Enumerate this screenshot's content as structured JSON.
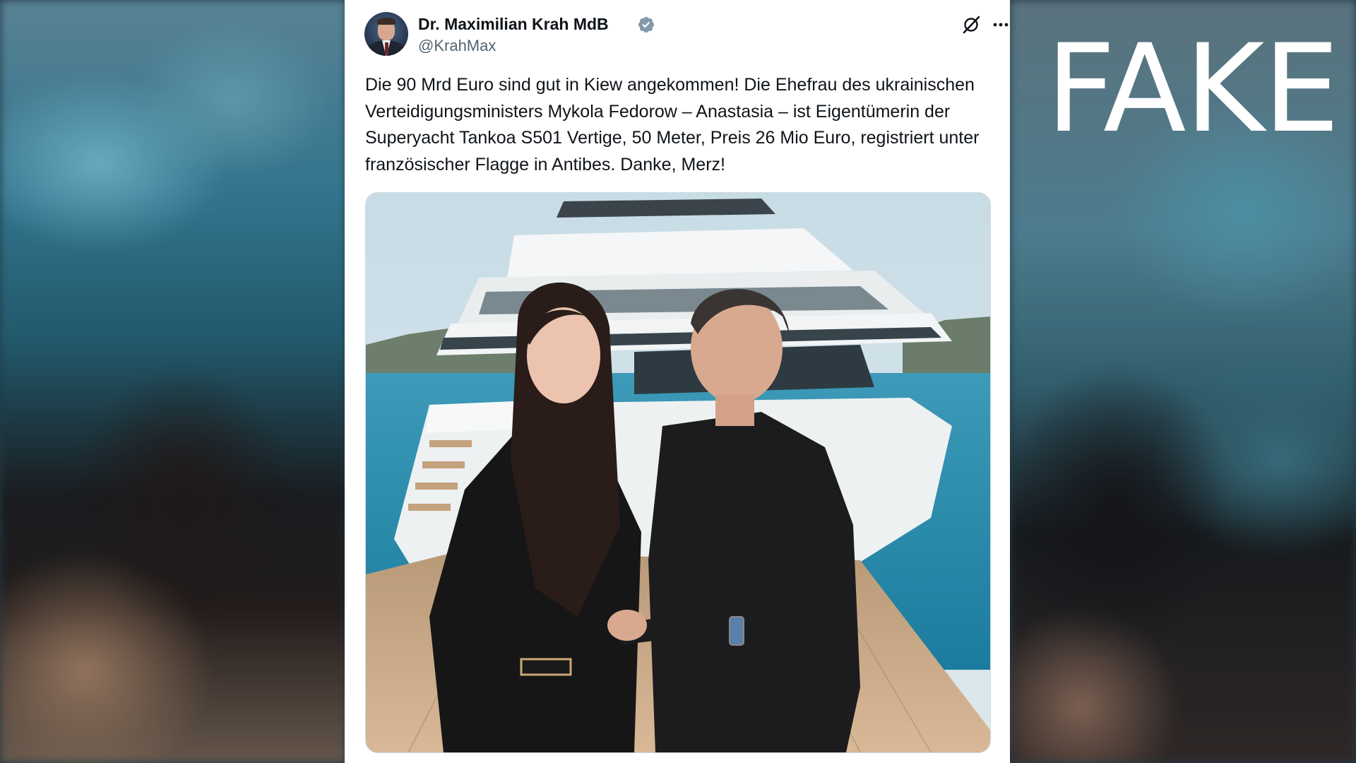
{
  "overlay": {
    "label": "FAKE"
  },
  "tweet": {
    "author": {
      "display_name": "Dr. Maximilian Krah MdB",
      "handle": "@KrahMax",
      "verified": true
    },
    "text": "Die 90 Mrd Euro sind gut in Kiew angekommen! Die Ehefrau des ukrainischen Verteidigungsministers Mykola Fedorow – Anastasia – ist Eigentümerin der Superyacht Tankoa S501 Vertige, 50 Meter, Preis 26 Mio Euro, registriert unter französischer Flagge in Antibes. Danke, Merz!",
    "media": {
      "kind": "photo",
      "subject": "couple-on-yacht-deck"
    }
  },
  "icons": {
    "verified": "verified-badge-icon",
    "grok": "grok-icon",
    "more": "more-options-icon"
  },
  "colors": {
    "verified_badge": "#829aab",
    "text_primary": "#0f1419",
    "text_secondary": "#536471",
    "fake_label": "#ffffff"
  }
}
